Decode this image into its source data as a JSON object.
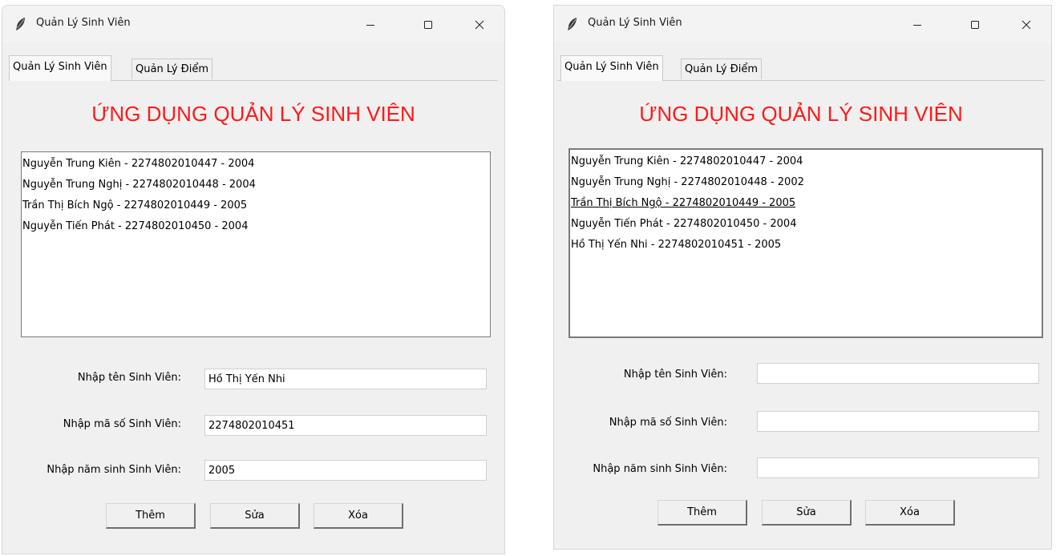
{
  "windows": [
    {
      "title": "Quản Lý Sinh Viên",
      "tabs": [
        {
          "label": "Quản Lý Sinh Viên",
          "active": true
        },
        {
          "label": "Quản Lý Điểm",
          "active": false
        }
      ],
      "heading": "ỨNG DỤNG QUẢN LÝ SINH VIÊN",
      "students": [
        "Nguyễn Trung Kiên  - 2274802010447 - 2004",
        "Nguyễn Trung Nghị  - 2274802010448 - 2004",
        "Trần Thị Bích Ngộ - 2274802010449 - 2005",
        "Nguyễn Tiến Phát  - 2274802010450 - 2004"
      ],
      "selected_index": null,
      "form": {
        "name_label": "Nhập tên Sinh Viên:",
        "name_value": "Hồ Thị Yến Nhi",
        "id_label": "Nhập mã số Sinh Viên:",
        "id_value": "2274802010451",
        "year_label": "Nhập năm sinh Sinh Viên:",
        "year_value": "2005"
      },
      "buttons": {
        "add": "Thêm",
        "edit": "Sửa",
        "delete": "Xóa"
      }
    },
    {
      "title": "Quản Lý Sinh Viên",
      "tabs": [
        {
          "label": "Quản Lý Sinh Viên",
          "active": true
        },
        {
          "label": "Quản Lý Điểm",
          "active": false
        }
      ],
      "heading": "ỨNG DỤNG QUẢN LÝ SINH VIÊN",
      "students": [
        "Nguyễn Trung Kiên  - 2274802010447 - 2004",
        "Nguyễn Trung Nghị - 2274802010448 - 2002",
        "Trần Thị Bích Ngộ - 2274802010449 - 2005",
        "Nguyễn Tiến Phát  - 2274802010450 - 2004",
        "Hồ Thị Yến Nhi - 2274802010451 - 2005"
      ],
      "selected_index": 2,
      "form": {
        "name_label": "Nhập tên Sinh Viên:",
        "name_value": "",
        "id_label": "Nhập mã số Sinh Viên:",
        "id_value": "",
        "year_label": "Nhập năm sinh Sinh Viên:",
        "year_value": ""
      },
      "buttons": {
        "add": "Thêm",
        "edit": "Sửa",
        "delete": "Xóa"
      }
    }
  ],
  "icons": {
    "app": "feather-icon",
    "minimize": "minimize-icon",
    "maximize": "maximize-icon",
    "close": "close-icon"
  },
  "colors": {
    "heading": "#ff1a1a",
    "window_bg": "#f0f0f0",
    "titlebar_bg": "#f3f3f3",
    "field_bg": "#ffffff"
  }
}
